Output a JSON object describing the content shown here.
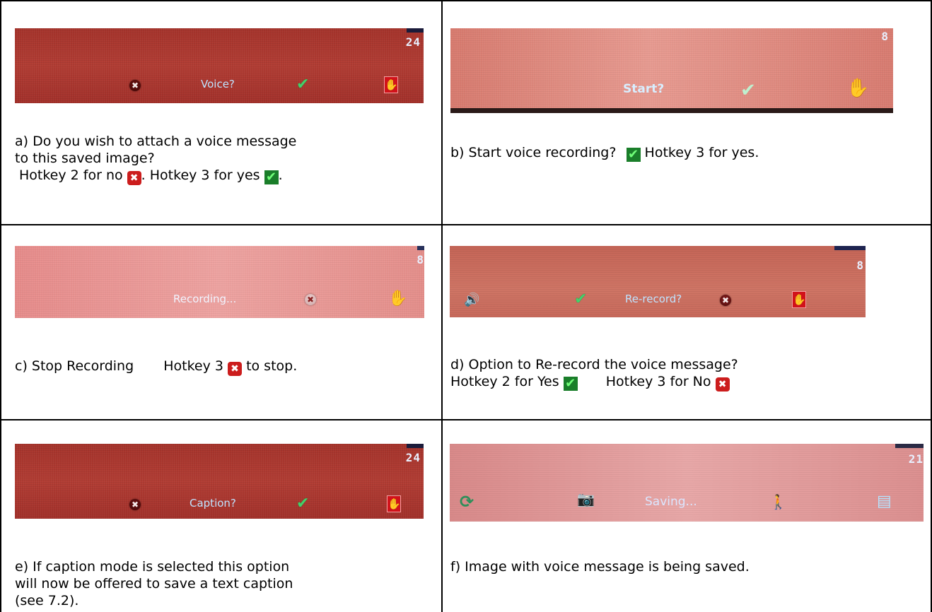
{
  "icons": {
    "cancel": "✖",
    "confirm": "✔",
    "stop_hand": "✋",
    "speaker": "🔊",
    "refresh": "⟳",
    "camera": "📷",
    "figure": "🚶",
    "document": "▤"
  },
  "colors": {
    "screen_dark_red": "#a5332b",
    "screen_pink": "#e79a90",
    "label_blue": "#bfe3ff",
    "check_green": "#43d16a",
    "x_red": "#cc1d1d"
  },
  "panels": {
    "a": {
      "counter": "24",
      "label": "Voice?",
      "caption_line1": "a) Do you wish to attach a voice message",
      "caption_line2": "to this saved image?",
      "caption_line3_part1": "Hotkey 2 for no",
      "caption_line3_part2": ". Hotkey 3 for yes",
      "caption_line3_part3": "."
    },
    "b": {
      "counter": "8",
      "label": "Start?",
      "caption_part1": "b) Start voice recording?",
      "caption_part2": "Hotkey 3 for yes."
    },
    "c": {
      "counter": "8",
      "label": "Recording...",
      "caption_part1": "c) Stop Recording",
      "caption_part2": "Hotkey 3",
      "caption_part3": "to stop."
    },
    "d": {
      "counter": "8",
      "label": "Re-record?",
      "caption_line1": "d) Option to Re-record the voice message?",
      "caption_line2_part1": "Hotkey 2 for Yes",
      "caption_line2_part2": "Hotkey 3 for No"
    },
    "e": {
      "counter": "24",
      "label": "Caption?",
      "caption_line1": "e) If caption mode is selected this option",
      "caption_line2": "will now be offered to save a text caption",
      "caption_line3": "(see 7.2)."
    },
    "f": {
      "counter": "21",
      "label": "Saving...",
      "caption": "f) Image with voice message is being saved."
    }
  }
}
